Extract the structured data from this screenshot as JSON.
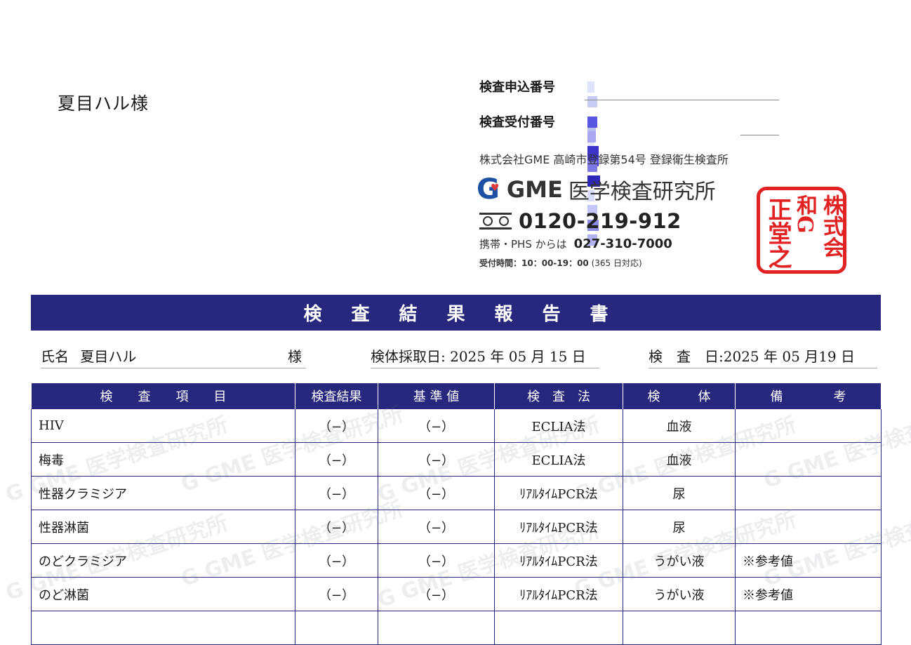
{
  "recipient": "夏目ハル様",
  "numbers": {
    "application_label": "検査申込番号",
    "reception_label": "検査受付番号"
  },
  "company": {
    "registration": "株式会社GME 高崎市登録第54号 登録衛生検査所",
    "brand_gme": "GME",
    "brand_lab": "医学検査研究所",
    "freedial": "0120-219-912",
    "mobile_label": "携帯・PHS からは",
    "mobile_number": "027-310-7000",
    "hours_label": "受付時間：10：00-19：00",
    "hours_note": "(365 日対応)"
  },
  "report_title": "検査結果報告書",
  "fields": {
    "name_label": "氏名",
    "name_value": "夏目ハル",
    "name_suffix": "様",
    "collection_label": "検体採取日:",
    "collection_year": "2025",
    "collection_month": "05",
    "collection_day": "15",
    "test_label": "検　査　日:",
    "test_year": "2025",
    "test_month": "05",
    "test_day": "19",
    "year_unit": "年",
    "month_unit": "月",
    "day_unit": "日"
  },
  "table": {
    "headers": [
      "検　　査　　項　　目",
      "検査結果",
      "基 準 値",
      "検　査　法",
      "検　　　体",
      "備　　　　考"
    ],
    "rows": [
      {
        "item": "HIV",
        "result": "（−）",
        "reference": "（−）",
        "method": "ECLIA法",
        "specimen": "血液",
        "note": ""
      },
      {
        "item": "梅毒",
        "result": "（−）",
        "reference": "（−）",
        "method": "ECLIA法",
        "specimen": "血液",
        "note": ""
      },
      {
        "item": "性器クラミジア",
        "result": "（−）",
        "reference": "（−）",
        "method": "ﾘｱﾙﾀｲﾑPCR法",
        "specimen": "尿",
        "note": ""
      },
      {
        "item": "性器淋菌",
        "result": "（−）",
        "reference": "（−）",
        "method": "ﾘｱﾙﾀｲﾑPCR法",
        "specimen": "尿",
        "note": ""
      },
      {
        "item": "のどクラミジア",
        "result": "（−）",
        "reference": "（−）",
        "method": "ﾘｱﾙﾀｲﾑPCR法",
        "specimen": "うがい液",
        "note": "※参考値"
      },
      {
        "item": "のど淋菌",
        "result": "（−）",
        "reference": "（−）",
        "method": "ﾘｱﾙﾀｲﾑPCR法",
        "specimen": "うがい液",
        "note": "※参考値"
      },
      {
        "item": "",
        "result": "",
        "reference": "",
        "method": "",
        "specimen": "",
        "note": ""
      }
    ]
  },
  "watermark_text": "G GME 医学検査研究所",
  "colors": {
    "header_navy": "#27287d",
    "seal_red": "#e22222",
    "brand_blue": "#1d4fa3"
  }
}
